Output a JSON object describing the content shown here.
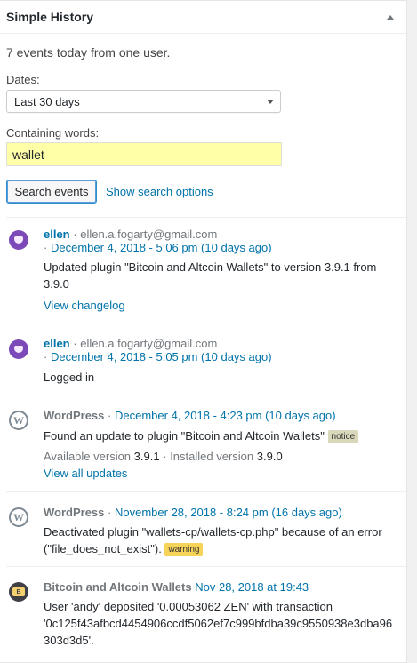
{
  "widget": {
    "title": "Simple History"
  },
  "summary": "7 events today from one user.",
  "filters": {
    "dates_label": "Dates:",
    "dates_value": "Last 30 days",
    "words_label": "Containing words:",
    "words_value": "wallet",
    "search_button": "Search events",
    "show_options": "Show search options"
  },
  "events": [
    {
      "initiator": "ellen",
      "email": "ellen.a.fogarty@gmail.com",
      "date": "December 4, 2018 - 5:06 pm (10 days ago)",
      "message_line1": "Updated plugin \"Bitcoin and Altcoin Wallets\" to version 3.9.1 from",
      "message_line2": "3.9.0",
      "link": "View changelog"
    },
    {
      "initiator": "ellen",
      "email": "ellen.a.fogarty@gmail.com",
      "date": "December 4, 2018 - 5:05 pm (10 days ago)",
      "message": "Logged in"
    },
    {
      "initiator": "WordPress",
      "date": "December 4, 2018 - 4:23 pm (10 days ago)",
      "message": "Found an update to plugin \"Bitcoin and Altcoin Wallets\"",
      "tag": "notice",
      "available_label": "Available version",
      "available_value": "3.9.1",
      "installed_label": "Installed version",
      "installed_value": "3.9.0",
      "link": "View all updates"
    },
    {
      "initiator": "WordPress",
      "date": "November 28, 2018 - 8:24 pm (16 days ago)",
      "message_line1": "Deactivated plugin \"wallets-cp/wallets-cp.php\" because of an error",
      "message_line2": "(\"file_does_not_exist\").",
      "tag": "warning"
    },
    {
      "initiator": "Bitcoin and Altcoin Wallets",
      "date": "Nov 28, 2018 at 19:43",
      "message_line1": "User 'andy' deposited '0.00053062 ZEN' with transaction",
      "message_line2": "'0c125f43afbcd4454906ccdf5062ef7c999bfdba39c9550938e3dba96",
      "message_line3": "303d3d5'."
    }
  ],
  "separator": "·"
}
